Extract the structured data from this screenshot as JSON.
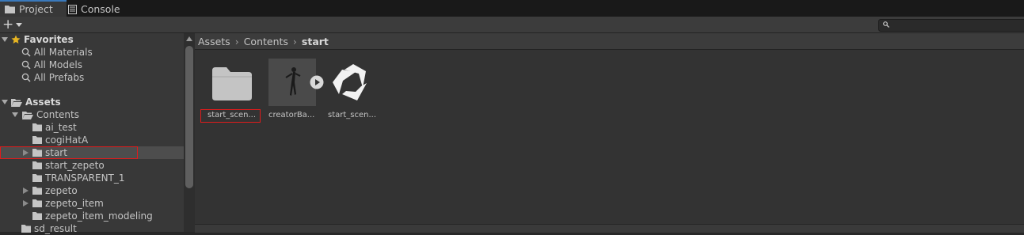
{
  "tabs": [
    {
      "label": "Project",
      "icon": "folder-icon",
      "active": true
    },
    {
      "label": "Console",
      "icon": "console-icon",
      "active": false
    }
  ],
  "toolbar": {
    "create_label": "+"
  },
  "tree": {
    "favorites": {
      "label": "Favorites",
      "items": [
        "All Materials",
        "All Models",
        "All Prefabs"
      ]
    },
    "assets": {
      "label": "Assets",
      "contents_label": "Contents",
      "children": [
        "ai_test",
        "cogiHatA",
        "start",
        "start_zepeto",
        "TRANSPARENT_1",
        "zepeto",
        "zepeto_item",
        "zepeto_item_modeling"
      ],
      "next_label": "sd_result"
    }
  },
  "breadcrumb": [
    "Assets",
    "Contents",
    "start"
  ],
  "assets": [
    {
      "label": "start_scen...",
      "icon": "folder-icon"
    },
    {
      "label": "creatorBa...",
      "icon": "character-model-icon"
    },
    {
      "label": "start_scen...",
      "icon": "unity-scene-icon"
    }
  ],
  "colors": {
    "highlight": "#e01b1b",
    "accent": "#3a79bb"
  }
}
